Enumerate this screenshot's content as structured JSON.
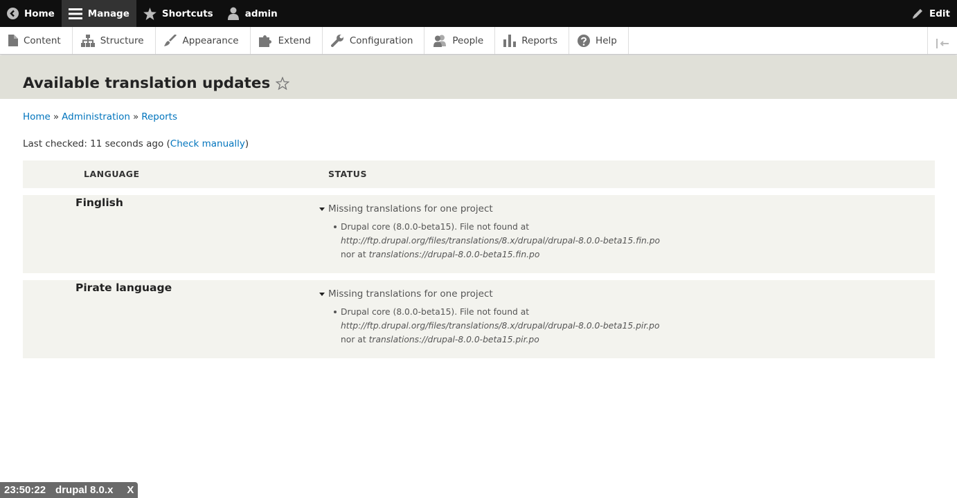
{
  "toolbar": {
    "home": "Home",
    "manage": "Manage",
    "shortcuts": "Shortcuts",
    "user": "admin",
    "edit": "Edit"
  },
  "tray": {
    "items": [
      {
        "label": "Content",
        "icon": "file-icon"
      },
      {
        "label": "Structure",
        "icon": "sitemap-icon"
      },
      {
        "label": "Appearance",
        "icon": "paintbrush-icon"
      },
      {
        "label": "Extend",
        "icon": "puzzle-icon"
      },
      {
        "label": "Configuration",
        "icon": "wrench-icon"
      },
      {
        "label": "People",
        "icon": "people-icon"
      },
      {
        "label": "Reports",
        "icon": "bar-chart-icon"
      },
      {
        "label": "Help",
        "icon": "help-icon"
      }
    ]
  },
  "page": {
    "title": "Available translation updates"
  },
  "breadcrumb": {
    "items": [
      "Home",
      "Administration",
      "Reports"
    ],
    "separator": "»"
  },
  "last_checked": {
    "prefix": "Last checked: 11 seconds ago (",
    "link": "Check manually",
    "suffix": ")"
  },
  "table": {
    "headers": [
      "LANGUAGE",
      "STATUS"
    ],
    "rows": [
      {
        "language": "Finglish",
        "summary": "Missing translations for one project",
        "detail_prefix": "Drupal core (8.0.0-beta15). File not found at ",
        "detail_url": "http://ftp.drupal.org/files/translations/8.x/drupal/drupal-8.0.0-beta15.fin.po",
        "detail_mid": " nor at ",
        "detail_local": "translations://drupal-8.0.0-beta15.fin.po"
      },
      {
        "language": "Pirate language",
        "summary": "Missing translations for one project",
        "detail_prefix": "Drupal core (8.0.0-beta15). File not found at ",
        "detail_url": "http://ftp.drupal.org/files/translations/8.x/drupal/drupal-8.0.0-beta15.pir.po",
        "detail_mid": " nor at ",
        "detail_local": "translations://drupal-8.0.0-beta15.pir.po"
      }
    ]
  },
  "status_badge": {
    "time": "23:50:22",
    "label": "drupal 8.0.x",
    "close": "X"
  },
  "colors": {
    "toolbar_bg": "#0f0f0f",
    "link": "#0074bd",
    "header_band": "#e0e0d8",
    "table_bg": "#f3f3ee"
  }
}
